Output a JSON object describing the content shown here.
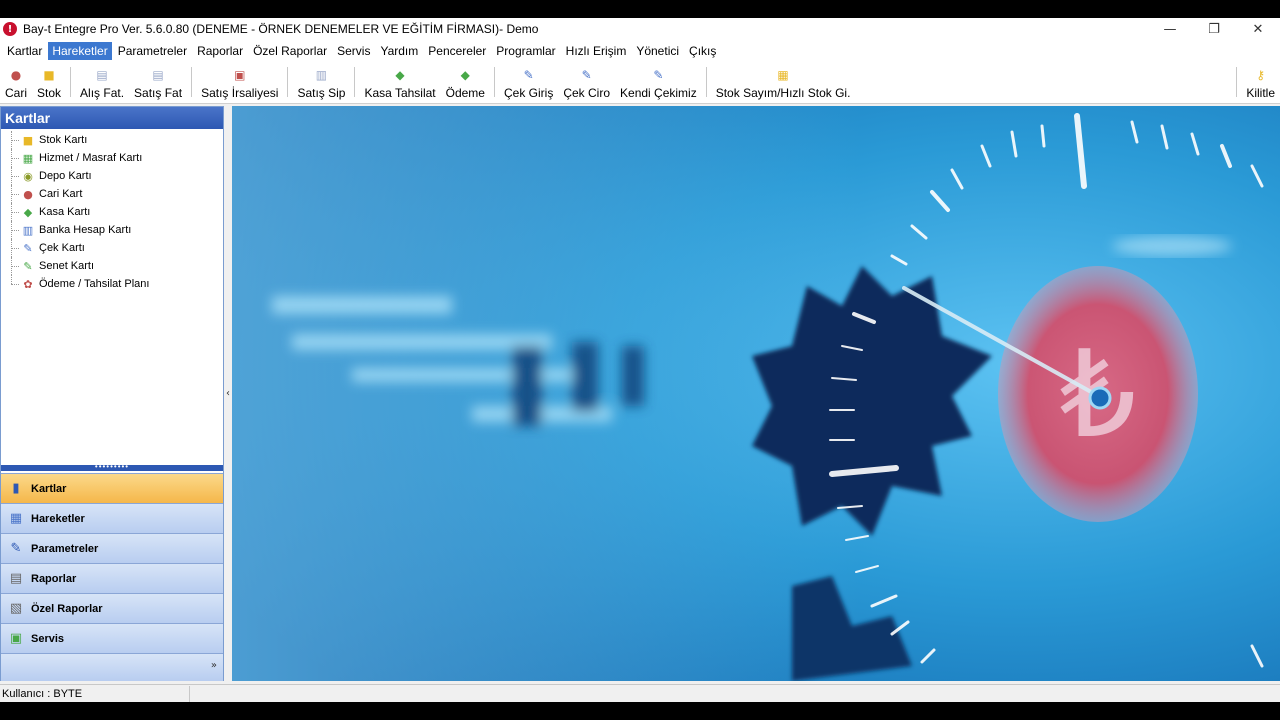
{
  "window": {
    "title": "Bay-t Entegre Pro Ver. 5.6.0.80 (DENEME - ÖRNEK DENEMELER VE EĞİTİM FİRMASI)- Demo",
    "minimize_glyph": "—",
    "maximize_glyph": "❐",
    "close_glyph": "✕"
  },
  "menu": [
    {
      "label": "Kartlar"
    },
    {
      "label": "Hareketler"
    },
    {
      "label": "Parametreler"
    },
    {
      "label": "Raporlar"
    },
    {
      "label": "Özel Raporlar"
    },
    {
      "label": "Servis"
    },
    {
      "label": "Yardım"
    },
    {
      "label": "Pencereler"
    },
    {
      "label": "Programlar"
    },
    {
      "label": "Hızlı Erişim"
    },
    {
      "label": "Yönetici"
    },
    {
      "label": "Çıkış"
    }
  ],
  "toolbar": [
    {
      "label": "Cari",
      "icon": "cari-icon",
      "color": "#c0504d"
    },
    {
      "label": "Stok",
      "icon": "stok-icon",
      "color": "#e8b828"
    },
    {
      "label": "Alış Fat.",
      "icon": "document-icon",
      "color": "#9aa8c8"
    },
    {
      "label": "Satış Fat",
      "icon": "document-icon",
      "color": "#9aa8c8"
    },
    {
      "label": "Satış İrsaliyesi",
      "icon": "delivery-icon",
      "color": "#c0504d"
    },
    {
      "label": "Satış Sip",
      "icon": "order-icon",
      "color": "#9aa8c8"
    },
    {
      "label": "Kasa Tahsilat",
      "icon": "cash-icon",
      "color": "#48a848"
    },
    {
      "label": "Ödeme",
      "icon": "cash-icon",
      "color": "#48a848"
    },
    {
      "label": "Çek Giriş",
      "icon": "cheque-icon",
      "color": "#4a74c9"
    },
    {
      "label": "Çek Ciro",
      "icon": "cheque-icon",
      "color": "#4a74c9"
    },
    {
      "label": "Kendi Çekimiz",
      "icon": "cheque-icon",
      "color": "#4a74c9"
    },
    {
      "label": "Stok Sayım/Hızlı Stok Gi.",
      "icon": "stock-count-icon",
      "color": "#e8b828"
    },
    {
      "label": "Kilitle",
      "icon": "key-icon",
      "color": "#e8b828"
    }
  ],
  "left_panel": {
    "title": "Kartlar",
    "tree": [
      {
        "label": "Stok Kartı",
        "icon": "stok-icon",
        "color": "#e8b828"
      },
      {
        "label": "Hizmet / Masraf Kartı",
        "icon": "service-icon",
        "color": "#48a848"
      },
      {
        "label": "Depo Kartı",
        "icon": "warehouse-icon",
        "color": "#8a9a28"
      },
      {
        "label": "Cari Kart",
        "icon": "cari-icon",
        "color": "#c0504d"
      },
      {
        "label": "Kasa Kartı",
        "icon": "cash-icon",
        "color": "#48a848"
      },
      {
        "label": "Banka Hesap Kartı",
        "icon": "bank-icon",
        "color": "#4a74c9"
      },
      {
        "label": "Çek Kartı",
        "icon": "cheque-icon",
        "color": "#4a74c9"
      },
      {
        "label": "Senet Kartı",
        "icon": "note-icon",
        "color": "#48a848"
      },
      {
        "label": "Ödeme / Tahsilat Planı",
        "icon": "plan-icon",
        "color": "#c0504d"
      }
    ],
    "nav": [
      {
        "label": "Kartlar",
        "icon": "cards-icon",
        "active": true
      },
      {
        "label": "Hareketler",
        "icon": "grid-icon",
        "active": false
      },
      {
        "label": "Parametreler",
        "icon": "params-icon",
        "active": false
      },
      {
        "label": "Raporlar",
        "icon": "printer-icon",
        "active": false
      },
      {
        "label": "Özel Raporlar",
        "icon": "custom-report-icon",
        "active": false
      },
      {
        "label": "Servis",
        "icon": "service-icon",
        "active": false
      }
    ]
  },
  "status": {
    "user": "Kullanıcı : BYTE"
  },
  "colors": {
    "accent": "#2d58b3",
    "menu_active": "#3c78d0",
    "nav_active": "#f5b74a"
  }
}
